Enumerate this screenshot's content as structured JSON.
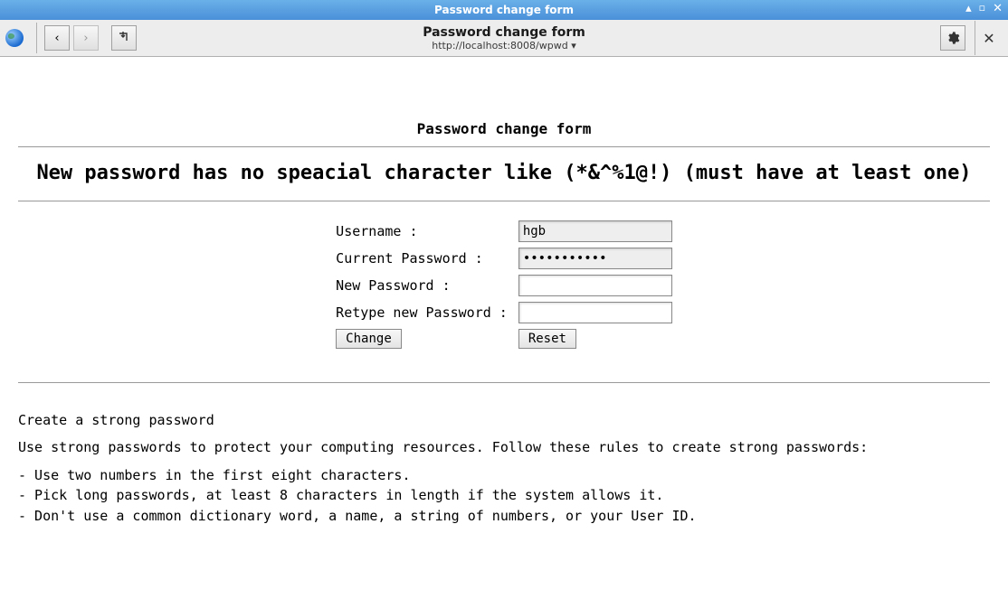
{
  "window": {
    "title": "Password change form"
  },
  "toolbar": {
    "page_title": "Password change form",
    "url": "http://localhost:8008/wpwd ▾"
  },
  "page": {
    "heading": "Password change form",
    "error_message": "New password has no speacial character like (*&^%1@!) (must have at least one)",
    "form": {
      "username_label": "Username :",
      "username_value": "hgb",
      "current_pw_label": "Current Password :",
      "current_pw_value": "•••••••••••",
      "new_pw_label": "New Password :",
      "new_pw_value": "",
      "retype_pw_label": "Retype new Password :",
      "retype_pw_value": "",
      "change_btn": "Change",
      "reset_btn": "Reset"
    },
    "help": {
      "title": "Create a strong password",
      "intro": "Use strong passwords to protect your computing resources. Follow these rules to create strong passwords:",
      "rule1": "- Use two numbers in the first eight characters.",
      "rule2": "- Pick long passwords, at least 8 characters in length if the system allows it.",
      "rule3": "- Don't use a common dictionary word, a name, a string of numbers, or your User ID."
    }
  }
}
